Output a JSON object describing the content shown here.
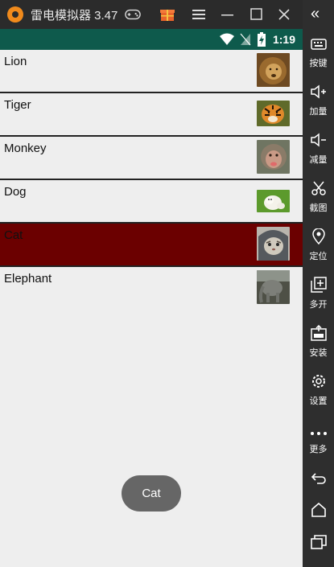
{
  "app": {
    "title": "雷电模拟器 3.47",
    "logo_color": "#f08a1c"
  },
  "titlebar_icons": [
    "gamepad-icon",
    "gift-icon",
    "menu-icon",
    "minimize-icon",
    "maximize-icon",
    "close-icon"
  ],
  "statusbar": {
    "time": "1:19",
    "background": "#0e5a4c"
  },
  "list": {
    "items": [
      {
        "label": "Lion",
        "selected": false
      },
      {
        "label": "Tiger",
        "selected": false
      },
      {
        "label": "Monkey",
        "selected": false
      },
      {
        "label": "Dog",
        "selected": false
      },
      {
        "label": "Cat",
        "selected": true
      },
      {
        "label": "Elephant",
        "selected": false
      }
    ],
    "selected_color": "#6b0000"
  },
  "toast": {
    "text": "Cat"
  },
  "sidebar": {
    "items": [
      {
        "label": "按键",
        "icon": "keyboard-icon"
      },
      {
        "label": "加量",
        "icon": "volume-up-icon"
      },
      {
        "label": "减量",
        "icon": "volume-down-icon"
      },
      {
        "label": "截图",
        "icon": "scissors-icon"
      },
      {
        "label": "定位",
        "icon": "location-icon"
      },
      {
        "label": "多开",
        "icon": "multi-instance-icon"
      },
      {
        "label": "安装",
        "icon": "apk-install-icon"
      },
      {
        "label": "设置",
        "icon": "gear-icon"
      },
      {
        "label": "更多",
        "icon": "more-icon"
      }
    ]
  }
}
